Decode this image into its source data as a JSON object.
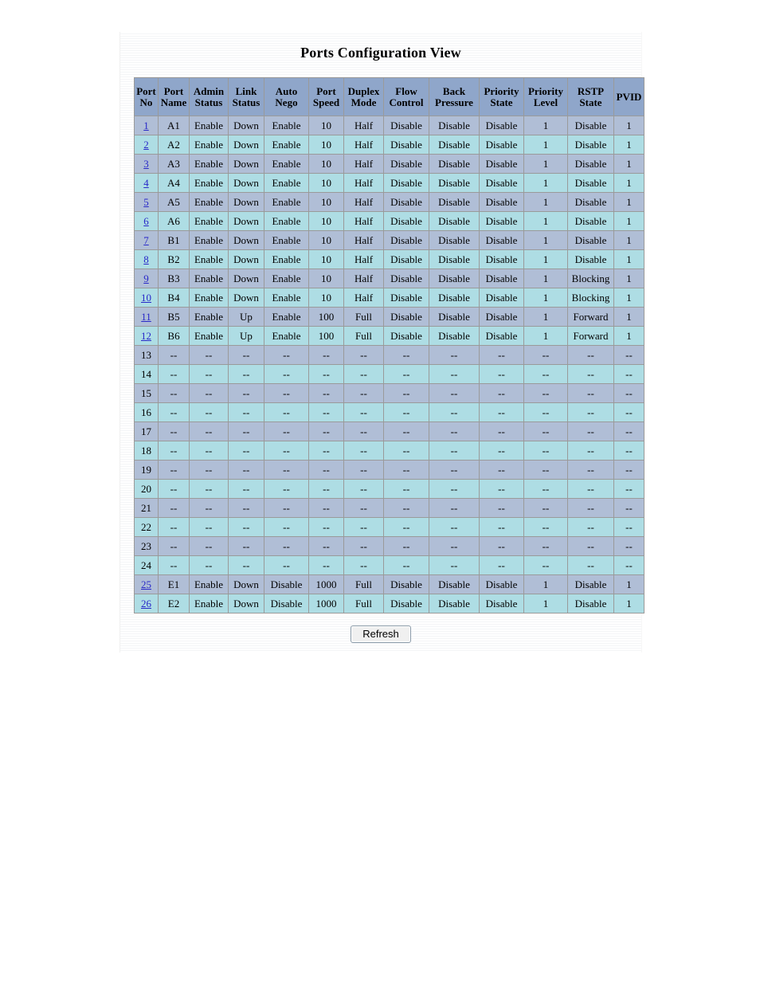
{
  "page": {
    "title": "Ports Configuration View",
    "refresh_label": "Refresh",
    "empty_value": "--"
  },
  "colors": {
    "header_bg": "#8fa6ca",
    "row_odd_bg": "#b0bed6",
    "row_even_bg": "#aedde4",
    "border": "#9a9a9a",
    "link": "#2828c8",
    "text": "#000000",
    "page_bg": "#ffffff"
  },
  "table": {
    "columns": [
      {
        "key": "port_no",
        "line1": "Port",
        "line2": "No"
      },
      {
        "key": "port_name",
        "line1": "Port",
        "line2": "Name"
      },
      {
        "key": "admin_status",
        "line1": "Admin",
        "line2": "Status"
      },
      {
        "key": "link_status",
        "line1": "Link",
        "line2": "Status"
      },
      {
        "key": "auto_nego",
        "line1": "Auto",
        "line2": "Nego"
      },
      {
        "key": "port_speed",
        "line1": "Port",
        "line2": "Speed"
      },
      {
        "key": "duplex_mode",
        "line1": "Duplex",
        "line2": "Mode"
      },
      {
        "key": "flow_control",
        "line1": "Flow",
        "line2": "Control"
      },
      {
        "key": "back_pressure",
        "line1": "Back",
        "line2": "Pressure"
      },
      {
        "key": "priority_state",
        "line1": "Priority",
        "line2": "State"
      },
      {
        "key": "priority_level",
        "line1": "Priority",
        "line2": "Level"
      },
      {
        "key": "rstp_state",
        "line1": "RSTP",
        "line2": "State"
      },
      {
        "key": "pvid",
        "line1": "PVID",
        "line2": ""
      }
    ],
    "rows": [
      {
        "port_no": "1",
        "is_link": true,
        "port_name": "A1",
        "admin_status": "Enable",
        "link_status": "Down",
        "auto_nego": "Enable",
        "port_speed": "10",
        "duplex_mode": "Half",
        "flow_control": "Disable",
        "back_pressure": "Disable",
        "priority_state": "Disable",
        "priority_level": "1",
        "rstp_state": "Disable",
        "pvid": "1"
      },
      {
        "port_no": "2",
        "is_link": true,
        "port_name": "A2",
        "admin_status": "Enable",
        "link_status": "Down",
        "auto_nego": "Enable",
        "port_speed": "10",
        "duplex_mode": "Half",
        "flow_control": "Disable",
        "back_pressure": "Disable",
        "priority_state": "Disable",
        "priority_level": "1",
        "rstp_state": "Disable",
        "pvid": "1"
      },
      {
        "port_no": "3",
        "is_link": true,
        "port_name": "A3",
        "admin_status": "Enable",
        "link_status": "Down",
        "auto_nego": "Enable",
        "port_speed": "10",
        "duplex_mode": "Half",
        "flow_control": "Disable",
        "back_pressure": "Disable",
        "priority_state": "Disable",
        "priority_level": "1",
        "rstp_state": "Disable",
        "pvid": "1"
      },
      {
        "port_no": "4",
        "is_link": true,
        "port_name": "A4",
        "admin_status": "Enable",
        "link_status": "Down",
        "auto_nego": "Enable",
        "port_speed": "10",
        "duplex_mode": "Half",
        "flow_control": "Disable",
        "back_pressure": "Disable",
        "priority_state": "Disable",
        "priority_level": "1",
        "rstp_state": "Disable",
        "pvid": "1"
      },
      {
        "port_no": "5",
        "is_link": true,
        "port_name": "A5",
        "admin_status": "Enable",
        "link_status": "Down",
        "auto_nego": "Enable",
        "port_speed": "10",
        "duplex_mode": "Half",
        "flow_control": "Disable",
        "back_pressure": "Disable",
        "priority_state": "Disable",
        "priority_level": "1",
        "rstp_state": "Disable",
        "pvid": "1"
      },
      {
        "port_no": "6",
        "is_link": true,
        "port_name": "A6",
        "admin_status": "Enable",
        "link_status": "Down",
        "auto_nego": "Enable",
        "port_speed": "10",
        "duplex_mode": "Half",
        "flow_control": "Disable",
        "back_pressure": "Disable",
        "priority_state": "Disable",
        "priority_level": "1",
        "rstp_state": "Disable",
        "pvid": "1"
      },
      {
        "port_no": "7",
        "is_link": true,
        "port_name": "B1",
        "admin_status": "Enable",
        "link_status": "Down",
        "auto_nego": "Enable",
        "port_speed": "10",
        "duplex_mode": "Half",
        "flow_control": "Disable",
        "back_pressure": "Disable",
        "priority_state": "Disable",
        "priority_level": "1",
        "rstp_state": "Disable",
        "pvid": "1"
      },
      {
        "port_no": "8",
        "is_link": true,
        "port_name": "B2",
        "admin_status": "Enable",
        "link_status": "Down",
        "auto_nego": "Enable",
        "port_speed": "10",
        "duplex_mode": "Half",
        "flow_control": "Disable",
        "back_pressure": "Disable",
        "priority_state": "Disable",
        "priority_level": "1",
        "rstp_state": "Disable",
        "pvid": "1"
      },
      {
        "port_no": "9",
        "is_link": true,
        "port_name": "B3",
        "admin_status": "Enable",
        "link_status": "Down",
        "auto_nego": "Enable",
        "port_speed": "10",
        "duplex_mode": "Half",
        "flow_control": "Disable",
        "back_pressure": "Disable",
        "priority_state": "Disable",
        "priority_level": "1",
        "rstp_state": "Blocking",
        "pvid": "1"
      },
      {
        "port_no": "10",
        "is_link": true,
        "port_name": "B4",
        "admin_status": "Enable",
        "link_status": "Down",
        "auto_nego": "Enable",
        "port_speed": "10",
        "duplex_mode": "Half",
        "flow_control": "Disable",
        "back_pressure": "Disable",
        "priority_state": "Disable",
        "priority_level": "1",
        "rstp_state": "Blocking",
        "pvid": "1"
      },
      {
        "port_no": "11",
        "is_link": true,
        "port_name": "B5",
        "admin_status": "Enable",
        "link_status": "Up",
        "auto_nego": "Enable",
        "port_speed": "100",
        "duplex_mode": "Full",
        "flow_control": "Disable",
        "back_pressure": "Disable",
        "priority_state": "Disable",
        "priority_level": "1",
        "rstp_state": "Forward",
        "pvid": "1"
      },
      {
        "port_no": "12",
        "is_link": true,
        "port_name": "B6",
        "admin_status": "Enable",
        "link_status": "Up",
        "auto_nego": "Enable",
        "port_speed": "100",
        "duplex_mode": "Full",
        "flow_control": "Disable",
        "back_pressure": "Disable",
        "priority_state": "Disable",
        "priority_level": "1",
        "rstp_state": "Forward",
        "pvid": "1"
      },
      {
        "port_no": "13",
        "is_link": false,
        "port_name": "--",
        "admin_status": "--",
        "link_status": "--",
        "auto_nego": "--",
        "port_speed": "--",
        "duplex_mode": "--",
        "flow_control": "--",
        "back_pressure": "--",
        "priority_state": "--",
        "priority_level": "--",
        "rstp_state": "--",
        "pvid": "--"
      },
      {
        "port_no": "14",
        "is_link": false,
        "port_name": "--",
        "admin_status": "--",
        "link_status": "--",
        "auto_nego": "--",
        "port_speed": "--",
        "duplex_mode": "--",
        "flow_control": "--",
        "back_pressure": "--",
        "priority_state": "--",
        "priority_level": "--",
        "rstp_state": "--",
        "pvid": "--"
      },
      {
        "port_no": "15",
        "is_link": false,
        "port_name": "--",
        "admin_status": "--",
        "link_status": "--",
        "auto_nego": "--",
        "port_speed": "--",
        "duplex_mode": "--",
        "flow_control": "--",
        "back_pressure": "--",
        "priority_state": "--",
        "priority_level": "--",
        "rstp_state": "--",
        "pvid": "--"
      },
      {
        "port_no": "16",
        "is_link": false,
        "port_name": "--",
        "admin_status": "--",
        "link_status": "--",
        "auto_nego": "--",
        "port_speed": "--",
        "duplex_mode": "--",
        "flow_control": "--",
        "back_pressure": "--",
        "priority_state": "--",
        "priority_level": "--",
        "rstp_state": "--",
        "pvid": "--"
      },
      {
        "port_no": "17",
        "is_link": false,
        "port_name": "--",
        "admin_status": "--",
        "link_status": "--",
        "auto_nego": "--",
        "port_speed": "--",
        "duplex_mode": "--",
        "flow_control": "--",
        "back_pressure": "--",
        "priority_state": "--",
        "priority_level": "--",
        "rstp_state": "--",
        "pvid": "--"
      },
      {
        "port_no": "18",
        "is_link": false,
        "port_name": "--",
        "admin_status": "--",
        "link_status": "--",
        "auto_nego": "--",
        "port_speed": "--",
        "duplex_mode": "--",
        "flow_control": "--",
        "back_pressure": "--",
        "priority_state": "--",
        "priority_level": "--",
        "rstp_state": "--",
        "pvid": "--"
      },
      {
        "port_no": "19",
        "is_link": false,
        "port_name": "--",
        "admin_status": "--",
        "link_status": "--",
        "auto_nego": "--",
        "port_speed": "--",
        "duplex_mode": "--",
        "flow_control": "--",
        "back_pressure": "--",
        "priority_state": "--",
        "priority_level": "--",
        "rstp_state": "--",
        "pvid": "--"
      },
      {
        "port_no": "20",
        "is_link": false,
        "port_name": "--",
        "admin_status": "--",
        "link_status": "--",
        "auto_nego": "--",
        "port_speed": "--",
        "duplex_mode": "--",
        "flow_control": "--",
        "back_pressure": "--",
        "priority_state": "--",
        "priority_level": "--",
        "rstp_state": "--",
        "pvid": "--"
      },
      {
        "port_no": "21",
        "is_link": false,
        "port_name": "--",
        "admin_status": "--",
        "link_status": "--",
        "auto_nego": "--",
        "port_speed": "--",
        "duplex_mode": "--",
        "flow_control": "--",
        "back_pressure": "--",
        "priority_state": "--",
        "priority_level": "--",
        "rstp_state": "--",
        "pvid": "--"
      },
      {
        "port_no": "22",
        "is_link": false,
        "port_name": "--",
        "admin_status": "--",
        "link_status": "--",
        "auto_nego": "--",
        "port_speed": "--",
        "duplex_mode": "--",
        "flow_control": "--",
        "back_pressure": "--",
        "priority_state": "--",
        "priority_level": "--",
        "rstp_state": "--",
        "pvid": "--"
      },
      {
        "port_no": "23",
        "is_link": false,
        "port_name": "--",
        "admin_status": "--",
        "link_status": "--",
        "auto_nego": "--",
        "port_speed": "--",
        "duplex_mode": "--",
        "flow_control": "--",
        "back_pressure": "--",
        "priority_state": "--",
        "priority_level": "--",
        "rstp_state": "--",
        "pvid": "--"
      },
      {
        "port_no": "24",
        "is_link": false,
        "port_name": "--",
        "admin_status": "--",
        "link_status": "--",
        "auto_nego": "--",
        "port_speed": "--",
        "duplex_mode": "--",
        "flow_control": "--",
        "back_pressure": "--",
        "priority_state": "--",
        "priority_level": "--",
        "rstp_state": "--",
        "pvid": "--"
      },
      {
        "port_no": "25",
        "is_link": true,
        "port_name": "E1",
        "admin_status": "Enable",
        "link_status": "Down",
        "auto_nego": "Disable",
        "port_speed": "1000",
        "duplex_mode": "Full",
        "flow_control": "Disable",
        "back_pressure": "Disable",
        "priority_state": "Disable",
        "priority_level": "1",
        "rstp_state": "Disable",
        "pvid": "1"
      },
      {
        "port_no": "26",
        "is_link": true,
        "port_name": "E2",
        "admin_status": "Enable",
        "link_status": "Down",
        "auto_nego": "Disable",
        "port_speed": "1000",
        "duplex_mode": "Full",
        "flow_control": "Disable",
        "back_pressure": "Disable",
        "priority_state": "Disable",
        "priority_level": "1",
        "rstp_state": "Disable",
        "pvid": "1"
      }
    ]
  }
}
